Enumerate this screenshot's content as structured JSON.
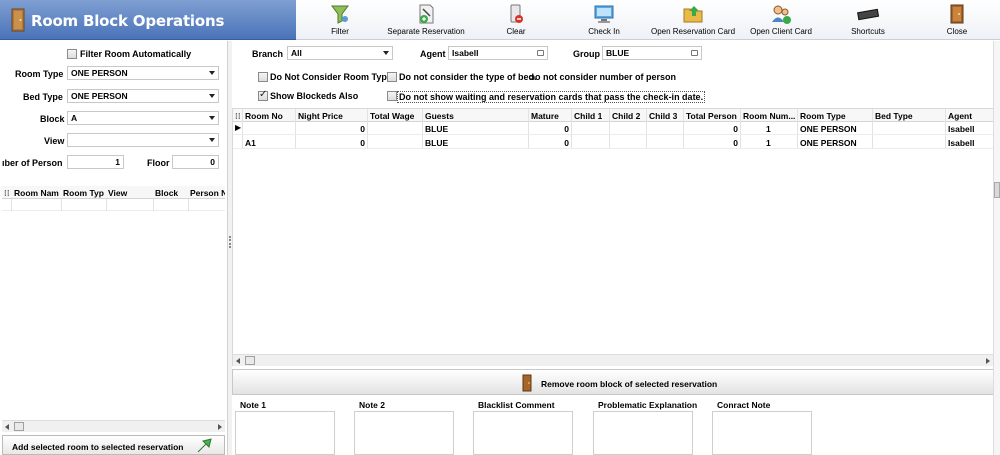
{
  "app": {
    "title": "Room Block Operations"
  },
  "toolbar": {
    "filter": "Filter",
    "separate_reservation": "Separate Reservation",
    "clear": "Clear",
    "check_in": "Check In",
    "open_reservation_card": "Open Reservation Card",
    "open_client_card": "Open Client Card",
    "shortcuts": "Shortcuts",
    "close": "Close"
  },
  "left": {
    "filter_room_auto": {
      "label": "Filter Room Automatically",
      "checked": false
    },
    "room_type": {
      "label": "Room Type",
      "value": "ONE PERSON"
    },
    "bed_type": {
      "label": "Bed Type",
      "value": "ONE PERSON"
    },
    "block": {
      "label": "Block",
      "value": "A"
    },
    "view": {
      "label": "View",
      "value": ""
    },
    "number_of_person": {
      "label": "ıber of Person",
      "value": "1"
    },
    "floor": {
      "label": "Floor",
      "value": "0"
    },
    "grid_columns": [
      "Room Nam",
      "Room Typ",
      "View",
      "Block",
      "Person N"
    ],
    "add_button": "Add selected room to selected reservation"
  },
  "filters": {
    "branch": {
      "label": "Branch",
      "value": "All"
    },
    "agent": {
      "label": "Agent",
      "value": "Isabell"
    },
    "group": {
      "label": "Group",
      "value": "BLUE"
    },
    "dont_consider_room_type": {
      "label": "Do Not Consider Room Type",
      "checked": false
    },
    "dont_consider_bed_type": {
      "label": "Do not consider the type of bed.",
      "checked": false
    },
    "dont_consider_person": {
      "label": "ɔo not consider number of person"
    },
    "show_blockeds": {
      "label": "Show Blockeds Also",
      "checked": true
    },
    "dont_show_waiting": {
      "label": "Do not show waiting and reservation cards that pass the check-in date.",
      "checked": false
    }
  },
  "grid": {
    "columns": [
      "Room No",
      "Night Price",
      "Total Wage",
      "Guests",
      "Mature",
      "Child 1",
      "Child 2",
      "Child 3",
      "Total Person",
      "Room Num...",
      "Room Type",
      "Bed Type",
      "Agent"
    ],
    "rows": [
      {
        "room_no": "",
        "night_price": "0",
        "total_wage": "",
        "guests": "BLUE",
        "mature": "0",
        "total_person": "0",
        "room_num": "1",
        "room_type": "ONE PERSON",
        "bed_type": "",
        "agent": "Isabell"
      },
      {
        "room_no": "A1",
        "night_price": "0",
        "total_wage": "",
        "guests": "BLUE",
        "mature": "0",
        "total_person": "0",
        "room_num": "1",
        "room_type": "ONE PERSON",
        "bed_type": "",
        "agent": "Isabell"
      }
    ]
  },
  "remove_button": "Remove room block of selected reservation",
  "notes": {
    "note1": "Note 1",
    "note2": "Note 2",
    "blacklist": "Blacklist Comment",
    "problematic": "Problematic Explanation",
    "contract": "Conract Note"
  }
}
